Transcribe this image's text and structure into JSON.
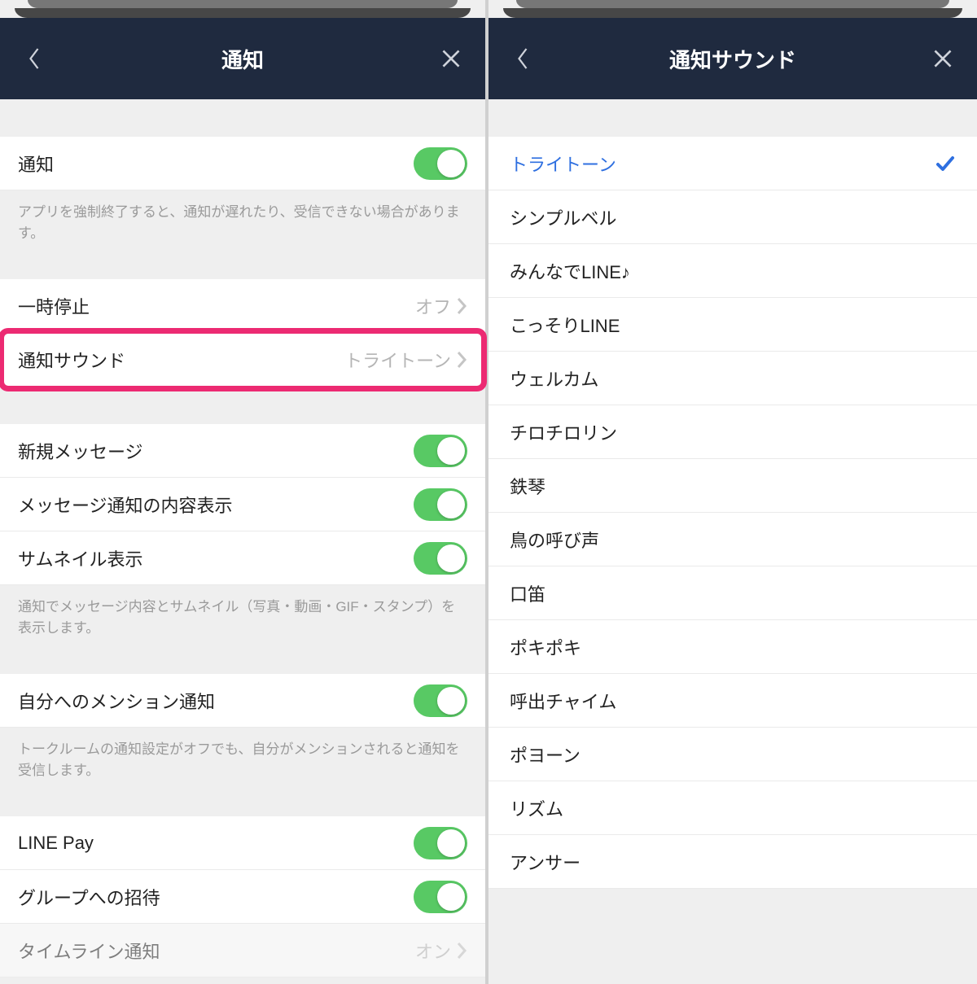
{
  "left": {
    "title": "通知",
    "notif_toggle_label": "通知",
    "caption1": "アプリを強制終了すると、通知が遅れたり、受信できない場合があります。",
    "pause_label": "一時停止",
    "pause_value": "オフ",
    "sound_label": "通知サウンド",
    "sound_value": "トライトーン",
    "new_msg_label": "新規メッセージ",
    "msg_content_label": "メッセージ通知の内容表示",
    "thumb_label": "サムネイル表示",
    "caption2": "通知でメッセージ内容とサムネイル（写真・動画・GIF・スタンプ）を表示します。",
    "mention_label": "自分へのメンション通知",
    "caption3": "トークルームの通知設定がオフでも、自分がメンションされると通知を受信します。",
    "linepay_label": "LINE Pay",
    "group_invite_label": "グループへの招待",
    "timeline_label": "タイムライン通知",
    "timeline_value": "オン"
  },
  "right": {
    "title": "通知サウンド",
    "sounds": [
      "トライトーン",
      "シンプルベル",
      "みんなでLINE♪",
      "こっそりLINE",
      "ウェルカム",
      "チロチロリン",
      "鉄琴",
      "鳥の呼び声",
      "口笛",
      "ポキポキ",
      "呼出チャイム",
      "ポヨーン",
      "リズム",
      "アンサー"
    ],
    "selected_index": 0
  }
}
